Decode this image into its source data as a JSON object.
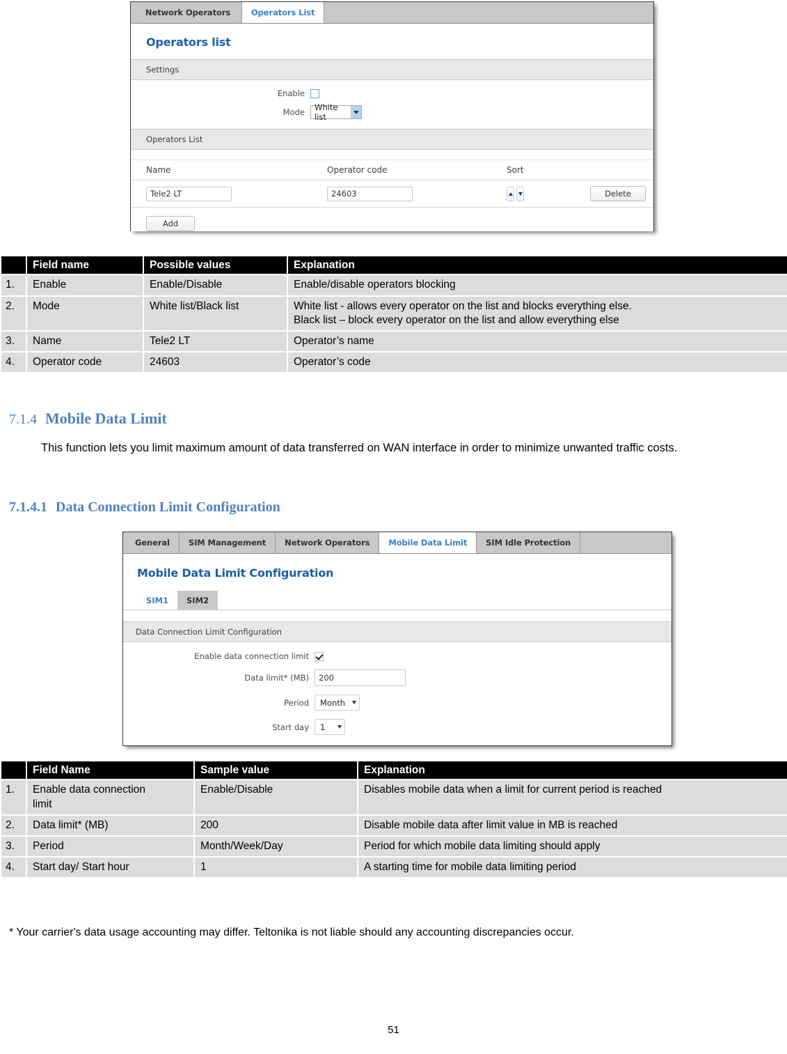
{
  "document": {
    "page_number": "51",
    "footnote": "* Your carrier's data usage accounting may differ. Teltonika is not liable should any accounting discrepancies occur.",
    "headings": {
      "h3_number": "7.1.4",
      "h3_title": "Mobile Data Limit",
      "h4_number": "7.1.4.1",
      "h4_title": "Data Connection Limit Configuration"
    },
    "paragraph": "This function lets you limit maximum amount of data transferred on WAN interface in order to minimize unwanted traffic costs.",
    "heading_color": "#4f81bd"
  },
  "screenshot_operators": {
    "tabs": [
      {
        "label": "Network Operators",
        "active": false
      },
      {
        "label": "Operators List",
        "active": true
      }
    ],
    "title": "Operators list",
    "settings_bar": "Settings",
    "enable_label": "Enable",
    "enable_checked": false,
    "mode_label": "Mode",
    "mode_value": "White list",
    "list_bar": "Operators List",
    "columns": {
      "name": "Name",
      "operator_code": "Operator code",
      "sort": "Sort"
    },
    "row": {
      "name_value": "Tele2 LT",
      "code_value": "24603",
      "delete_label": "Delete"
    },
    "add_label": "Add"
  },
  "screenshot_datalimit": {
    "tabs": [
      {
        "label": "General",
        "active": false
      },
      {
        "label": "SIM Management",
        "active": false
      },
      {
        "label": "Network Operators",
        "active": false
      },
      {
        "label": "Mobile Data Limit",
        "active": true
      },
      {
        "label": "SIM Idle Protection",
        "active": false
      }
    ],
    "title": "Mobile Data Limit Configuration",
    "subtabs": [
      {
        "label": "SIM1",
        "active": true
      },
      {
        "label": "SIM2",
        "active": false
      }
    ],
    "section_bar": "Data Connection Limit Configuration",
    "fields": {
      "enable_label": "Enable data connection limit",
      "enable_checked": true,
      "data_limit_label": "Data limit* (MB)",
      "data_limit_value": "200",
      "period_label": "Period",
      "period_value": "Month",
      "start_day_label": "Start day",
      "start_day_value": "1"
    }
  },
  "table_operators": {
    "headers": [
      "",
      "Field name",
      "Possible values",
      "Explanation"
    ],
    "rows": [
      {
        "num": "1.",
        "field": "Enable",
        "values": "Enable/Disable",
        "explanation_line1": "Enable/disable operators blocking",
        "explanation_line2": ""
      },
      {
        "num": "2.",
        "field": "Mode",
        "values": "White list/Black list",
        "explanation_line1": "White list - allows every operator on the list and blocks everything else.",
        "explanation_line2": "Black list – block every operator on the list and allow everything else"
      },
      {
        "num": "3.",
        "field": "Name",
        "values": "Tele2 LT",
        "explanation_line1": "Operator’s name",
        "explanation_line2": ""
      },
      {
        "num": "4.",
        "field": "Operator code",
        "values": "24603",
        "explanation_line1": "Operator’s code",
        "explanation_line2": ""
      }
    ]
  },
  "table_datalimit": {
    "headers": [
      "",
      "Field Name",
      "Sample value",
      "Explanation"
    ],
    "rows": [
      {
        "num": "1.",
        "field": "Enable data connection limit",
        "values": "Enable/Disable",
        "explanation": "Disables mobile data when a limit for current period is reached"
      },
      {
        "num": "2.",
        "field": "Data limit* (MB)",
        "values": "200",
        "explanation": "Disable mobile data after limit value in MB is reached"
      },
      {
        "num": "3.",
        "field": "Period",
        "values": "Month/Week/Day",
        "explanation": "Period for which mobile data limiting should apply"
      },
      {
        "num": "4.",
        "field": "Start day/ Start hour",
        "values": "1",
        "explanation": "A starting time for mobile data limiting period"
      }
    ]
  }
}
